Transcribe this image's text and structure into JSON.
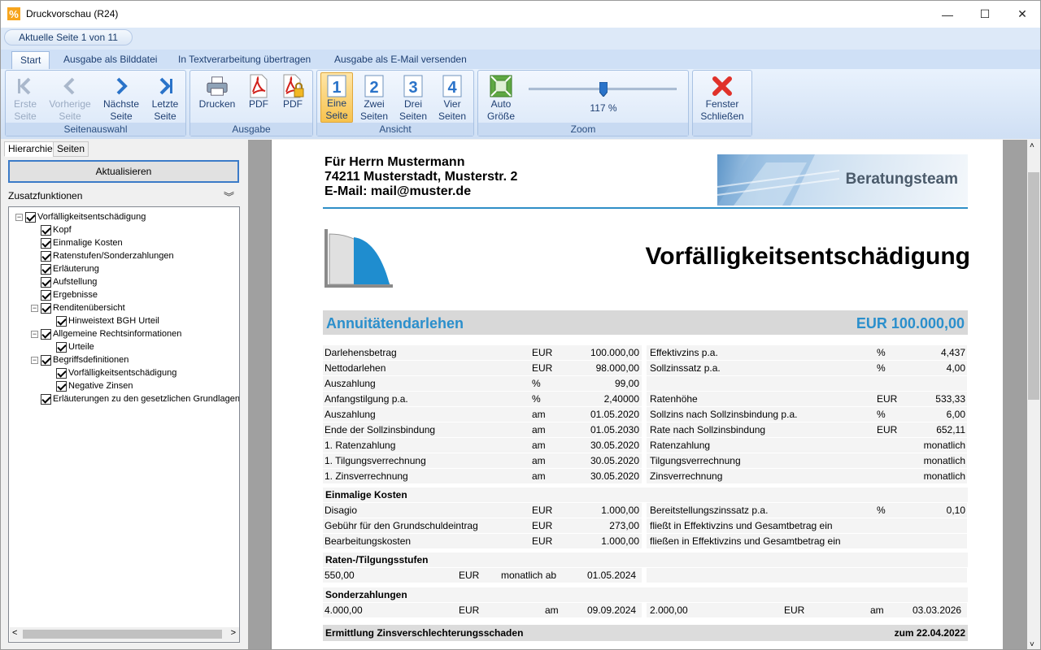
{
  "window": {
    "title": "Druckvorschau (R24)",
    "minimize": "—",
    "maximize": "☐",
    "close": "✕"
  },
  "ribbon": {
    "page_indicator": "Aktuelle Seite 1 von 11",
    "tabs": [
      "Start",
      "Ausgabe als Bilddatei",
      "In Textverarbeitung übertragen",
      "Ausgabe als E-Mail versenden"
    ],
    "groups": {
      "seitenauswahl": "Seitenauswahl",
      "ausgabe": "Ausgabe",
      "ansicht": "Ansicht",
      "zoom": "Zoom",
      "close": ""
    },
    "buttons": {
      "erste": [
        "Erste",
        "Seite"
      ],
      "vorherige": [
        "Vorherige",
        "Seite"
      ],
      "naechste": [
        "Nächste",
        "Seite"
      ],
      "letzte": [
        "Letzte",
        "Seite"
      ],
      "drucken": "Drucken",
      "pdf1": "PDF",
      "pdf2": "PDF",
      "eine": [
        "Eine",
        "Seite"
      ],
      "zwei": [
        "Zwei",
        "Seiten"
      ],
      "drei": [
        "Drei",
        "Seiten"
      ],
      "vier": [
        "Vier",
        "Seiten"
      ],
      "auto": [
        "Auto",
        "Größe"
      ],
      "fenster": [
        "Fenster",
        "Schließen"
      ]
    },
    "zoom": {
      "value_label": "117 %",
      "slider_fraction": 0.5
    }
  },
  "left_panel": {
    "tabs": [
      "Hierarchie",
      "Seiten"
    ],
    "refresh": "Aktualisieren",
    "zusatz": "Zusatzfunktionen",
    "tree": [
      {
        "label": "Vorfälligkeitsentschädigung",
        "level": 0,
        "expand": "−"
      },
      {
        "label": "Kopf",
        "level": 1
      },
      {
        "label": "Einmalige Kosten",
        "level": 1
      },
      {
        "label": "Ratenstufen/Sonderzahlungen",
        "level": 1
      },
      {
        "label": "Erläuterung",
        "level": 1
      },
      {
        "label": "Aufstellung",
        "level": 1
      },
      {
        "label": "Ergebnisse",
        "level": 1
      },
      {
        "label": "Renditenübersicht",
        "level": 1,
        "expand": "−"
      },
      {
        "label": "Hinweistext BGH Urteil",
        "level": 2
      },
      {
        "label": "Allgemeine Rechtsinformationen",
        "level": 1,
        "expand": "−"
      },
      {
        "label": "Urteile",
        "level": 2
      },
      {
        "label": "Begriffsdefinitionen",
        "level": 1,
        "expand": "−"
      },
      {
        "label": "Vorfälligkeitsentschädigung",
        "level": 2
      },
      {
        "label": "Negative Zinsen",
        "level": 2
      },
      {
        "label": "Erläuterungen zu den gesetzlichen Grundlagen d",
        "level": 1
      }
    ]
  },
  "doc": {
    "address": [
      "Für Herrn  Mustermann",
      "74211 Musterstadt,  Musterstr. 2",
      "E-Mail: mail@muster.de"
    ],
    "banner": "Beratungsteam",
    "title": "Vorfälligkeitsentschädigung",
    "band_left": "Annuitätendarlehen",
    "band_right": "EUR 100.000,00",
    "rows": [
      {
        "l": [
          "Darlehensbetrag",
          "EUR",
          "100.000,00"
        ],
        "r": [
          "Effektivzins p.a.",
          "%",
          "4,437"
        ]
      },
      {
        "l": [
          "Nettodarlehen",
          "EUR",
          "98.000,00"
        ],
        "r": [
          "Sollzinssatz p.a.",
          "%",
          "4,00"
        ]
      },
      {
        "l": [
          "Auszahlung",
          "%",
          "99,00"
        ],
        "r": [
          "",
          "",
          ""
        ]
      },
      {
        "l": [
          "Anfangstilgung p.a.",
          "%",
          "2,40000"
        ],
        "r": [
          "Ratenhöhe",
          "EUR",
          "533,33"
        ]
      },
      {
        "l": [
          "Auszahlung",
          "am",
          "01.05.2020"
        ],
        "r": [
          "Sollzins nach Sollzinsbindung p.a.",
          "%",
          "6,00"
        ]
      },
      {
        "l": [
          "Ende der Sollzinsbindung",
          "am",
          "01.05.2030"
        ],
        "r": [
          "Rate nach Sollzinsbindung",
          "EUR",
          "652,11"
        ]
      },
      {
        "l": [
          "1. Ratenzahlung",
          "am",
          "30.05.2020"
        ],
        "r": [
          "Ratenzahlung",
          "",
          "monatlich"
        ]
      },
      {
        "l": [
          "1. Tilgungsverrechnung",
          "am",
          "30.05.2020"
        ],
        "r": [
          "Tilgungsverrechnung",
          "",
          "monatlich"
        ]
      },
      {
        "l": [
          "1. Zinsverrechnung",
          "am",
          "30.05.2020"
        ],
        "r": [
          "Zinsverrechnung",
          "",
          "monatlich"
        ]
      }
    ],
    "kosten_title": "Einmalige Kosten",
    "kosten": [
      {
        "l": [
          "Disagio",
          "EUR",
          "1.000,00"
        ],
        "r": [
          "Bereitstellungszinssatz p.a.",
          "%",
          "0,10"
        ]
      },
      {
        "l": [
          "Gebühr für den Grundschuldeintrag",
          "EUR",
          "273,00"
        ],
        "r": [
          "fließt in Effektivzins und Gesamtbetrag ein",
          "",
          ""
        ]
      },
      {
        "l": [
          "Bearbeitungskosten",
          "EUR",
          "1.000,00"
        ],
        "r": [
          "fließen in Effektivzins und Gesamtbetrag ein",
          "",
          ""
        ]
      }
    ],
    "raten_title": "Raten-/Tilgungsstufen",
    "raten": [
      "550,00",
      "EUR",
      "monatlich ab",
      "01.05.2024"
    ],
    "sonder_title": "Sonderzahlungen",
    "sonder": [
      "4.000,00",
      "EUR",
      "am",
      "09.09.2024",
      "2.000,00",
      "EUR",
      "am",
      "03.03.2026"
    ],
    "ermittlung": "Ermittlung  Zinsverschlechterungsschaden",
    "ermittlung_date": "zum 22.04.2022"
  }
}
